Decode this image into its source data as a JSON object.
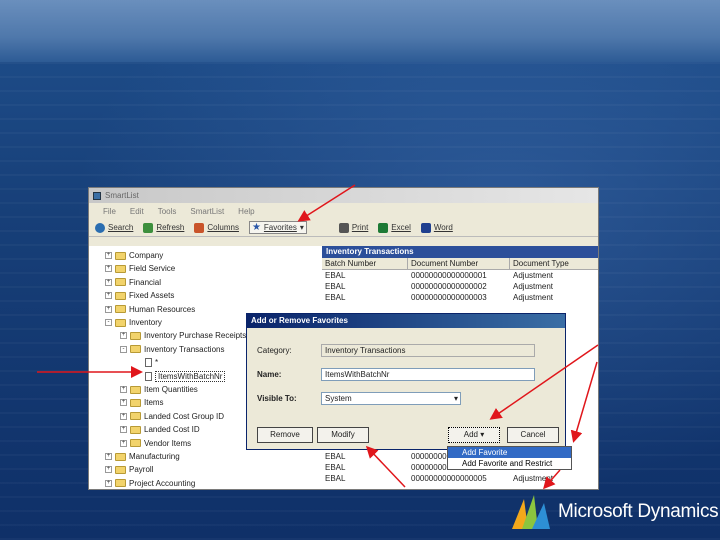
{
  "window": {
    "title": "SmartList",
    "menu": [
      "File",
      "Edit",
      "Tools",
      "SmartList",
      "Help"
    ],
    "toolbar": [
      {
        "label": "Search",
        "icon": "search-icon",
        "color": "#2a6db0"
      },
      {
        "label": "Refresh",
        "icon": "refresh-icon",
        "color": "#3d8f3d"
      },
      {
        "label": "Columns",
        "icon": "columns-icon",
        "color": "#c9542a"
      },
      {
        "label": "Favorites",
        "icon": "star-icon",
        "color": "#2b57a8"
      },
      {
        "label": "Print",
        "icon": "print-icon",
        "color": "#555555"
      },
      {
        "label": "Excel",
        "icon": "excel-icon",
        "color": "#1d7a35"
      },
      {
        "label": "Word",
        "icon": "word-icon",
        "color": "#1f3f8f"
      }
    ]
  },
  "tree": [
    {
      "label": "Company",
      "level": 0,
      "sign": "+"
    },
    {
      "label": "Field Service",
      "level": 0,
      "sign": "+"
    },
    {
      "label": "Financial",
      "level": 0,
      "sign": "+"
    },
    {
      "label": "Fixed Assets",
      "level": 0,
      "sign": "+"
    },
    {
      "label": "Human Resources",
      "level": 0,
      "sign": "+"
    },
    {
      "label": "Inventory",
      "level": 0,
      "sign": "-"
    },
    {
      "label": "Inventory Purchase Receipts",
      "level": 1,
      "sign": "+"
    },
    {
      "label": "Inventory Transactions",
      "level": 1,
      "sign": "-"
    },
    {
      "label": "*",
      "level": 2,
      "sign": "",
      "doc": true
    },
    {
      "label": "ItemsWithBatchNr",
      "level": 2,
      "sign": "",
      "doc": true,
      "selected": true
    },
    {
      "label": "Item Quantities",
      "level": 1,
      "sign": "+"
    },
    {
      "label": "Items",
      "level": 1,
      "sign": "+"
    },
    {
      "label": "Landed Cost Group ID",
      "level": 1,
      "sign": "+"
    },
    {
      "label": "Landed Cost ID",
      "level": 1,
      "sign": "+"
    },
    {
      "label": "Vendor Items",
      "level": 1,
      "sign": "+"
    },
    {
      "label": "Manufacturing",
      "level": 0,
      "sign": "+"
    },
    {
      "label": "Payroll",
      "level": 0,
      "sign": "+"
    },
    {
      "label": "Project Accounting",
      "level": 0,
      "sign": "+"
    }
  ],
  "grid": {
    "title": "Inventory Transactions",
    "columns": [
      "Batch Number",
      "Document Number",
      "Document Type"
    ],
    "rows": [
      [
        "EBAL",
        "00000000000000001",
        "Adjustment"
      ],
      [
        "EBAL",
        "00000000000000002",
        "Adjustment"
      ],
      [
        "EBAL",
        "00000000000000003",
        "Adjustment"
      ]
    ],
    "bottom_rows": [
      [
        "EBAL",
        "00000000000000",
        ""
      ],
      [
        "EBAL",
        "00000000000000",
        ""
      ],
      [
        "EBAL",
        "00000000000000005",
        "Adjustment"
      ]
    ]
  },
  "dialog": {
    "title": "Add or Remove Favorites",
    "category_label": "Category:",
    "category_value": "Inventory Transactions",
    "name_label": "Name:",
    "name_value": "ItemsWithBatchNr",
    "visible_label": "Visible To:",
    "visible_value": "System",
    "remove_label": "Remove",
    "modify_label": "Modify",
    "add_label": "Add",
    "cancel_label": "Cancel"
  },
  "add_menu": [
    "Add Favorite",
    "Add Favorite and Restrict"
  ],
  "logo": {
    "text": "Microsoft Dynamics"
  },
  "colors": {
    "arrow": "#e0161b",
    "title_bar": "#0a246a",
    "grid_title": "#2c4f9a",
    "menu_highlight": "#316ac5"
  }
}
